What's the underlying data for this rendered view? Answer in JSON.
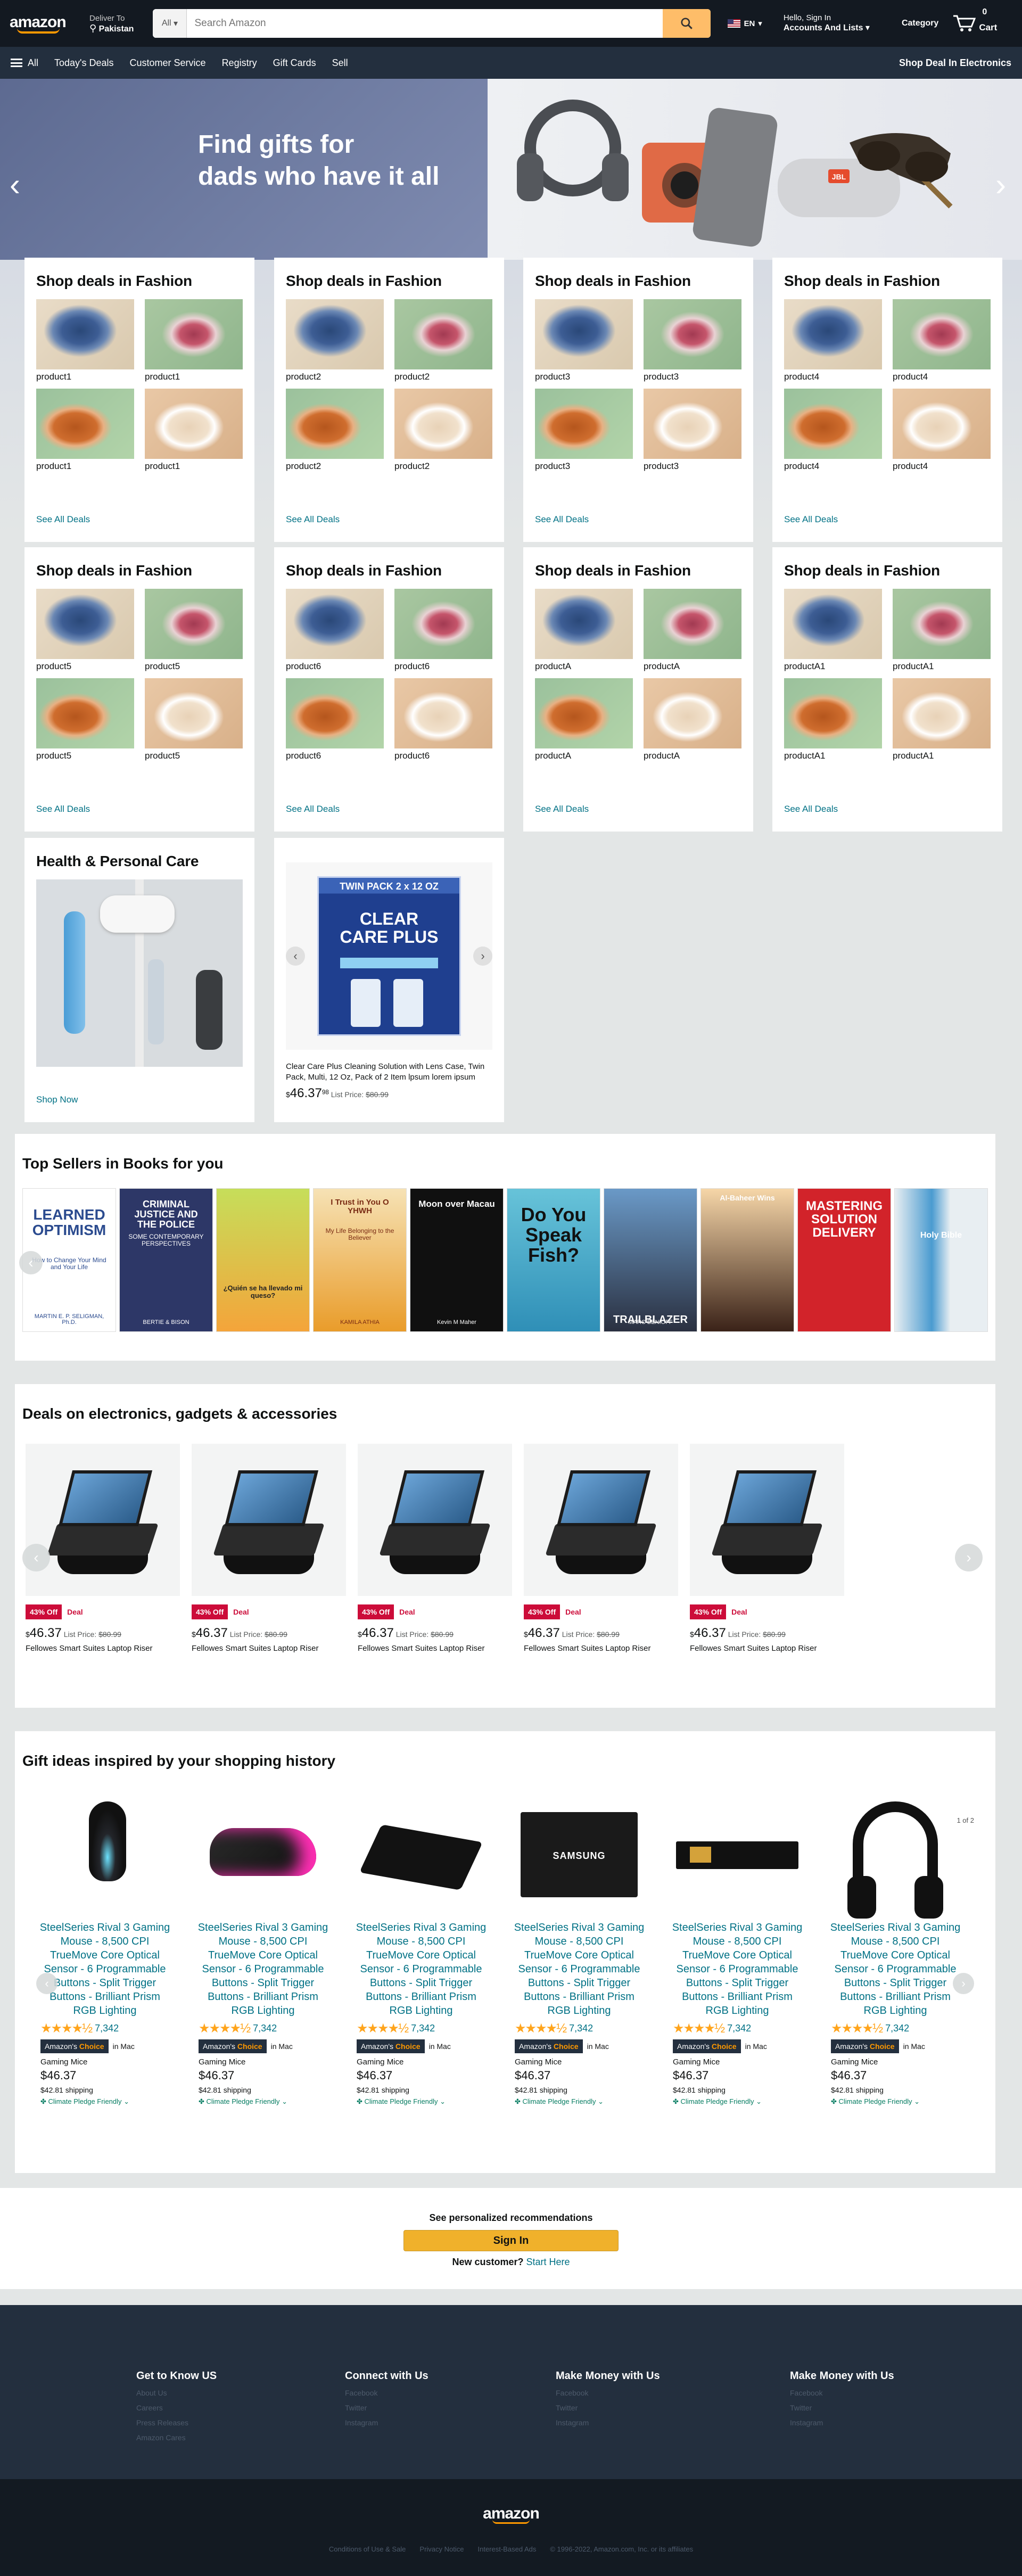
{
  "header": {
    "logo": "amazon",
    "deliver_line1": "Deliver To",
    "deliver_line2": "Pakistan",
    "search_category": "All",
    "search_placeholder": "Search Amazon",
    "language": "EN",
    "account_line1": "Hello, Sign In",
    "account_line2": "Accounts And Lists",
    "category": "Category",
    "cart_count": "0",
    "cart_label": "Cart"
  },
  "subnav": {
    "all": "All",
    "items": [
      "Today's Deals",
      "Customer Service",
      "Registry",
      "Gift Cards",
      "Sell"
    ],
    "right": "Shop Deal In Electronics"
  },
  "hero": {
    "title_line1": "Find gifts for",
    "title_line2": "dads who have it all",
    "product_brand": "JBL"
  },
  "fashion_cards": [
    {
      "title": "Shop deals in Fashion",
      "product": "product1",
      "link": "See All Deals"
    },
    {
      "title": "Shop deals in Fashion",
      "product": "product2",
      "link": "See All Deals"
    },
    {
      "title": "Shop deals in Fashion",
      "product": "product3",
      "link": "See All Deals"
    },
    {
      "title": "Shop deals in Fashion",
      "product": "product4",
      "link": "See All Deals"
    },
    {
      "title": "Shop deals in Fashion",
      "product": "product5",
      "link": "See All Deals"
    },
    {
      "title": "Shop deals in Fashion",
      "product": "product6",
      "link": "See All Deals"
    },
    {
      "title": "Shop deals in Fashion",
      "product": "productA",
      "link": "See All Deals"
    },
    {
      "title": "Shop deals in Fashion",
      "product": "productA1",
      "link": "See All Deals"
    }
  ],
  "health_card": {
    "title": "Health & Personal Care",
    "link": "Shop Now"
  },
  "clearcare_card": {
    "box_top": "TWIN PACK 2 x 12 OZ",
    "box_brand": "CLEAR CARE PLUS",
    "description": "Clear Care Plus Cleaning Solution with Lens Case, Twin Pack, Multi, 12 Oz, Pack of 2 Item lpsum lorem ipsum",
    "price_symbol": "$",
    "price_whole": "46.37",
    "price_cents": "98",
    "list_label": "List Price:",
    "list_price": "$80.99"
  },
  "books": {
    "title": "Top Sellers in Books for you",
    "items": [
      {
        "title": "LEARNED OPTIMISM",
        "sub": "How to Change Your Mind and Your Life",
        "author": "MARTIN E. P. SELIGMAN, Ph.D."
      },
      {
        "title": "CRIMINAL JUSTICE AND THE POLICE",
        "sub": "SOME CONTEMPORARY PERSPECTIVES",
        "author": "BERTIE & BISON"
      },
      {
        "title": "¿Quién se ha llevado mi queso?",
        "sub": "",
        "author": ""
      },
      {
        "title": "I Trust in You O YHWH",
        "sub": "My Life Belonging to the Believer",
        "author": "KAMILA ATHIA"
      },
      {
        "title": "Moon over Macau",
        "sub": "",
        "author": "Kevin M Maher"
      },
      {
        "title": "Do You Speak Fish?",
        "sub": "",
        "author": ""
      },
      {
        "title": "TRAILBLAZER",
        "sub": "",
        "author": "MARC BENIOFF"
      },
      {
        "title": "Al-Baheer Wins",
        "sub": "",
        "author": ""
      },
      {
        "title": "MASTERING SOLUTION DELIVERY",
        "sub": "",
        "author": ""
      },
      {
        "title": "Holy Bible",
        "sub": "",
        "author": ""
      }
    ]
  },
  "deals": {
    "title": "Deals on electronics, gadgets & accessories",
    "item": {
      "off": "43% Off",
      "deal": "Deal",
      "price_symbol": "$",
      "price": "46.37",
      "list_label": "List Price:",
      "list_price": "$80.99",
      "title": "Fellowes Smart Suites Laptop Riser"
    },
    "count": 5
  },
  "gifts": {
    "title": "Gift ideas inspired by your shopping history",
    "page_indicator": "1 of 2",
    "item": {
      "title": "SteelSeries Rival 3 Gaming Mouse - 8,500 CPI TrueMove Core Optical Sensor - 6 Programmable Buttons - Split Trigger Buttons - Brilliant Prism RGB Lighting",
      "rating_stars": 4.5,
      "reviews": "7,342",
      "choice_prefix": "Amazon's",
      "choice_suffix": "Choice",
      "in": "in Mac",
      "category": "Gaming Mice",
      "price": "$46.37",
      "shipping": "$42.81 shipping",
      "climate": "Climate Pledge Friendly"
    },
    "brands": [
      "",
      "",
      "",
      "SAMSUNG",
      "",
      ""
    ]
  },
  "signin": {
    "line1": "See personalized recommendations",
    "button": "Sign In",
    "line3": "New customer?",
    "link": "Start Here"
  },
  "footer": {
    "columns": [
      {
        "title": "Get to Know US",
        "links": [
          "About Us",
          "Careers",
          "Press Releases",
          "Amazon Cares"
        ]
      },
      {
        "title": "Connect with Us",
        "links": [
          "Facebook",
          "Twitter",
          "Instagram"
        ]
      },
      {
        "title": "Make Money with Us",
        "links": [
          "Facebook",
          "Twitter",
          "Instagram"
        ]
      },
      {
        "title": "Make Money with Us",
        "links": [
          "Facebook",
          "Twitter",
          "Instagram"
        ]
      }
    ],
    "bottom_logo": "amazon",
    "bottom_links": [
      "Conditions of Use & Sale",
      "Privacy Notice",
      "Interest-Based Ads",
      "© 1996-2022, Amazon.com, Inc. or its affiliates"
    ]
  },
  "colors": {
    "nav_dark": "#131921",
    "nav_mid": "#232f3e",
    "accent": "#ff9900",
    "link": "#007185",
    "deal_red": "#cc0c39",
    "search_button": "#febd69"
  }
}
